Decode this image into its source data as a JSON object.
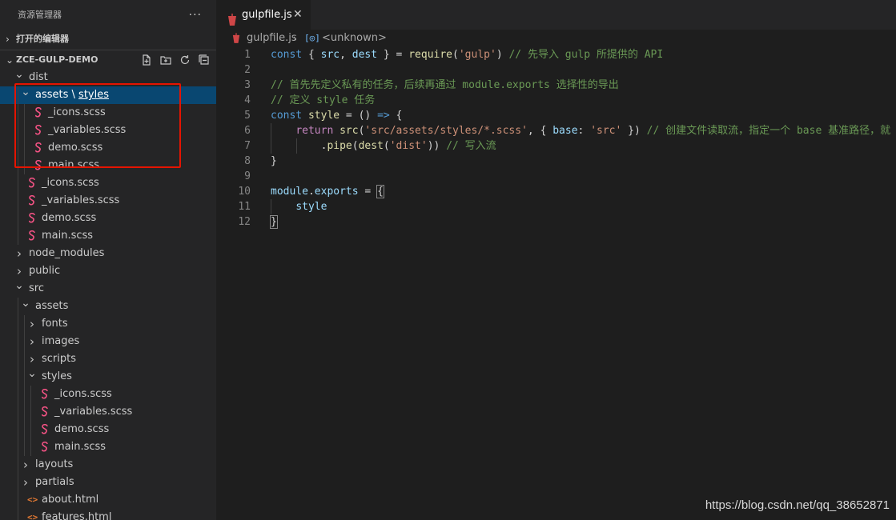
{
  "sidebar": {
    "title": "资源管理器",
    "more": "···",
    "open_editors": "打开的编辑器",
    "project": "ZCE-GULP-DEMO",
    "tree": [
      {
        "label": "dist",
        "depth": 0,
        "type": "folder",
        "open": true
      },
      {
        "label": "assets",
        "label2": "styles",
        "sep": " \\ ",
        "depth": 1,
        "type": "folder",
        "open": true,
        "selected": true
      },
      {
        "label": "_icons.scss",
        "depth": 2,
        "type": "scss"
      },
      {
        "label": "_variables.scss",
        "depth": 2,
        "type": "scss"
      },
      {
        "label": "demo.scss",
        "depth": 2,
        "type": "scss"
      },
      {
        "label": "main.scss",
        "depth": 2,
        "type": "scss"
      },
      {
        "label": "_icons.scss",
        "depth": 1,
        "type": "scss"
      },
      {
        "label": "_variables.scss",
        "depth": 1,
        "type": "scss"
      },
      {
        "label": "demo.scss",
        "depth": 1,
        "type": "scss"
      },
      {
        "label": "main.scss",
        "depth": 1,
        "type": "scss"
      },
      {
        "label": "node_modules",
        "depth": 0,
        "type": "folder",
        "open": false
      },
      {
        "label": "public",
        "depth": 0,
        "type": "folder",
        "open": false
      },
      {
        "label": "src",
        "depth": 0,
        "type": "folder",
        "open": true
      },
      {
        "label": "assets",
        "depth": 1,
        "type": "folder",
        "open": true
      },
      {
        "label": "fonts",
        "depth": 2,
        "type": "folder",
        "open": false
      },
      {
        "label": "images",
        "depth": 2,
        "type": "folder",
        "open": false
      },
      {
        "label": "scripts",
        "depth": 2,
        "type": "folder",
        "open": false
      },
      {
        "label": "styles",
        "depth": 2,
        "type": "folder",
        "open": true
      },
      {
        "label": "_icons.scss",
        "depth": 3,
        "type": "scss"
      },
      {
        "label": "_variables.scss",
        "depth": 3,
        "type": "scss"
      },
      {
        "label": "demo.scss",
        "depth": 3,
        "type": "scss"
      },
      {
        "label": "main.scss",
        "depth": 3,
        "type": "scss"
      },
      {
        "label": "layouts",
        "depth": 1,
        "type": "folder",
        "open": false
      },
      {
        "label": "partials",
        "depth": 1,
        "type": "folder",
        "open": false
      },
      {
        "label": "about.html",
        "depth": 1,
        "type": "html"
      },
      {
        "label": "features.html",
        "depth": 1,
        "type": "html"
      }
    ]
  },
  "editor": {
    "tab_label": "gulpfile.js",
    "tab_close": "✕",
    "breadcrumb_file": "gulpfile.js",
    "breadcrumb_sep": "›",
    "breadcrumb_symbol_icon": "[◎]",
    "breadcrumb_symbol": "<unknown>",
    "lines": [
      {
        "n": "1",
        "tokens": [
          [
            "kw",
            "const"
          ],
          [
            "punc",
            " { "
          ],
          [
            "var",
            "src"
          ],
          [
            "punc",
            ", "
          ],
          [
            "var",
            "dest"
          ],
          [
            "punc",
            " } = "
          ],
          [
            "fn",
            "require"
          ],
          [
            "punc",
            "("
          ],
          [
            "str",
            "'gulp'"
          ],
          [
            "punc",
            ") "
          ],
          [
            "cmt",
            "// 先导入 gulp 所提供的 API"
          ]
        ]
      },
      {
        "n": "2",
        "tokens": []
      },
      {
        "n": "3",
        "tokens": [
          [
            "cmt",
            "// 首先先定义私有的任务，后续再通过 module.exports 选择性的导出"
          ]
        ]
      },
      {
        "n": "4",
        "tokens": [
          [
            "cmt",
            "// 定义 style 任务"
          ]
        ]
      },
      {
        "n": "5",
        "tokens": [
          [
            "kw",
            "const"
          ],
          [
            "punc",
            " "
          ],
          [
            "fn",
            "style"
          ],
          [
            "punc",
            " = () "
          ],
          [
            "kw",
            "=>"
          ],
          [
            "punc",
            " {"
          ]
        ]
      },
      {
        "n": "6",
        "tokens": [
          [
            "punc",
            "    "
          ],
          [
            "kw2",
            "return"
          ],
          [
            "punc",
            " "
          ],
          [
            "fn",
            "src"
          ],
          [
            "punc",
            "("
          ],
          [
            "str",
            "'src/assets/styles/*.scss'"
          ],
          [
            "punc",
            ", { "
          ],
          [
            "var",
            "base"
          ],
          [
            "punc",
            ": "
          ],
          [
            "str",
            "'src'"
          ],
          [
            "punc",
            " }) "
          ],
          [
            "cmt",
            "// 创建文件读取流，指定一个 base 基准路径，就"
          ]
        ]
      },
      {
        "n": "7",
        "tokens": [
          [
            "punc",
            "        ."
          ],
          [
            "fn",
            "pipe"
          ],
          [
            "punc",
            "("
          ],
          [
            "fn",
            "dest"
          ],
          [
            "punc",
            "("
          ],
          [
            "str",
            "'dist'"
          ],
          [
            "punc",
            ")) "
          ],
          [
            "cmt",
            "// 写入流"
          ]
        ]
      },
      {
        "n": "8",
        "tokens": [
          [
            "punc",
            "}"
          ]
        ]
      },
      {
        "n": "9",
        "tokens": []
      },
      {
        "n": "10",
        "tokens": [
          [
            "var",
            "module"
          ],
          [
            "punc",
            "."
          ],
          [
            "var",
            "exports"
          ],
          [
            "punc",
            " = "
          ],
          [
            "bracket",
            "{"
          ]
        ]
      },
      {
        "n": "11",
        "tokens": [
          [
            "punc",
            "    "
          ],
          [
            "var",
            "style"
          ]
        ]
      },
      {
        "n": "12",
        "tokens": [
          [
            "bracket",
            "}"
          ]
        ]
      }
    ]
  },
  "watermark": "https://blog.csdn.net/qq_38652871",
  "colors": {
    "accent_select": "#094771",
    "highlight_box": "#e51400",
    "scss": "#f55385",
    "html": "#e37933"
  }
}
